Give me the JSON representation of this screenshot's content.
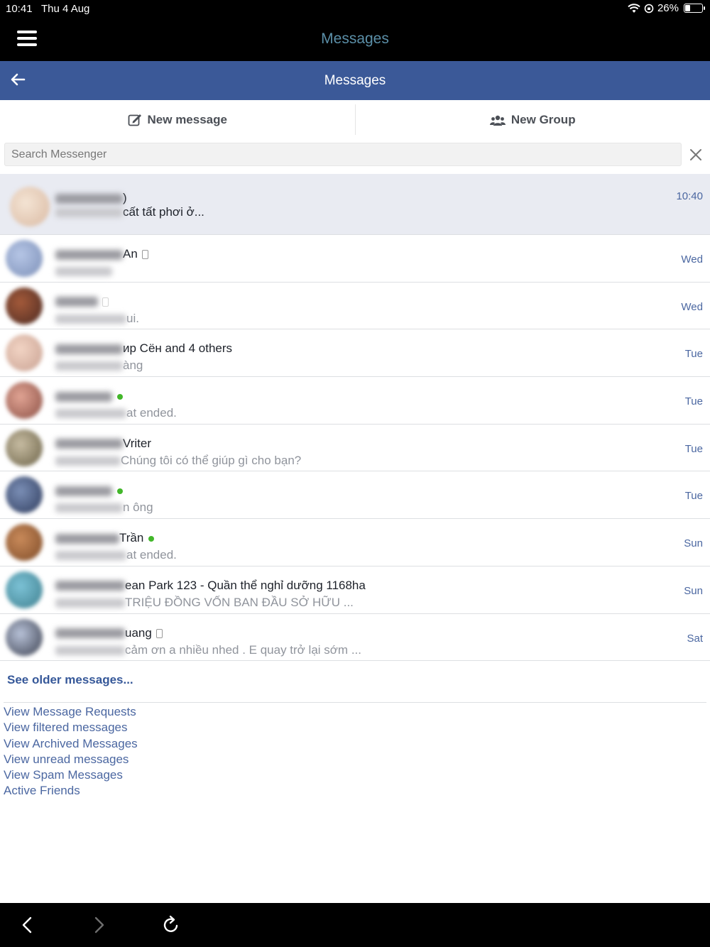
{
  "status_bar": {
    "time": "10:41",
    "date": "Thu 4 Aug",
    "battery": "26%",
    "battery_level": 0.26
  },
  "app_bar": {
    "title": "Messages"
  },
  "header": {
    "title": "Messages"
  },
  "actions": {
    "new_message": "New message",
    "new_group": "New Group"
  },
  "search": {
    "placeholder": "Search Messenger"
  },
  "threads": [
    {
      "name_visible": ")",
      "snippet_visible": "cất tất phơi ở...",
      "time": "10:40"
    },
    {
      "name_visible": "An",
      "snippet_visible": "",
      "time": "Wed"
    },
    {
      "name_visible": "",
      "snippet_visible": "ui.",
      "time": "Wed"
    },
    {
      "name_visible": "ир Сён and 4 others",
      "snippet_visible": "àng",
      "time": "Tue"
    },
    {
      "name_visible": "",
      "snippet_visible": "at ended.",
      "time": "Tue"
    },
    {
      "name_visible": "Vriter",
      "snippet_visible": "Chúng tôi có thể giúp gì cho bạn?",
      "time": "Tue"
    },
    {
      "name_visible": "",
      "snippet_visible": "n ông",
      "time": "Tue"
    },
    {
      "name_visible": "Trần",
      "snippet_visible": "at ended.",
      "time": "Sun"
    },
    {
      "name_visible": "ean Park 123 - Quần thể nghỉ dưỡng 1168ha",
      "snippet_visible": "TRIỆU ĐỒNG VỐN BAN ĐẦU SỞ HỮU ...",
      "time": "Sun"
    },
    {
      "name_visible": "uang",
      "snippet_visible": "cảm ơn a nhiều nhed . E quay trở lại sớm ...",
      "time": "Sat"
    }
  ],
  "see_older": "See older messages...",
  "links": [
    "View Message Requests",
    "View filtered messages",
    "View Archived Messages",
    "View unread messages",
    "View Spam Messages",
    "Active Friends"
  ],
  "colors": {
    "fb_blue": "#3b5998",
    "link": "#4b67a1",
    "online": "#42b72a"
  },
  "icons": [
    "hamburger-icon",
    "back-arrow-icon",
    "compose-icon",
    "group-icon",
    "close-icon",
    "wifi-icon",
    "battery-icon",
    "browser-back-icon",
    "browser-forward-icon",
    "reload-icon"
  ]
}
